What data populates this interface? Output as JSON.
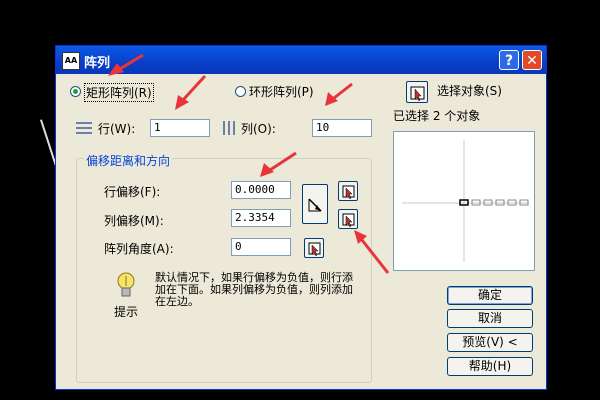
{
  "window": {
    "title": "阵列",
    "app_icon": "AA",
    "help_label": "?",
    "close_label": "✕"
  },
  "mode": {
    "rect_label": "矩形阵列(R)",
    "polar_label": "环形阵列(P)",
    "selected": "rect"
  },
  "rows": {
    "label": "行(W):",
    "value": "1",
    "icon": "rows-icon"
  },
  "columns": {
    "label": "列(O):",
    "value": "10",
    "icon": "columns-icon"
  },
  "offset_group": {
    "title": "偏移距离和方向",
    "row_offset_label": "行偏移(F):",
    "row_offset_value": "0.0000",
    "column_offset_label": "列偏移(M):",
    "column_offset_value": "2.3354",
    "angle_label": "阵列角度(A):",
    "angle_value": "0"
  },
  "tip": {
    "icon": "lightbulb-icon",
    "label": "提示",
    "text": "默认情况下，如果行偏移为负值，则行添加在下面。如果列偏移为负值，则列添加在左边。"
  },
  "select_objects": {
    "label": "选择对象(S)",
    "status": "已选择 2 个对象"
  },
  "buttons": {
    "ok": "确定",
    "cancel": "取消",
    "preview": "预览(V) <",
    "help": "帮助(H)"
  },
  "accent": {
    "titlebar": "#0a3ec9",
    "arrows": "#e8343a",
    "group_title": "#0046d5"
  }
}
